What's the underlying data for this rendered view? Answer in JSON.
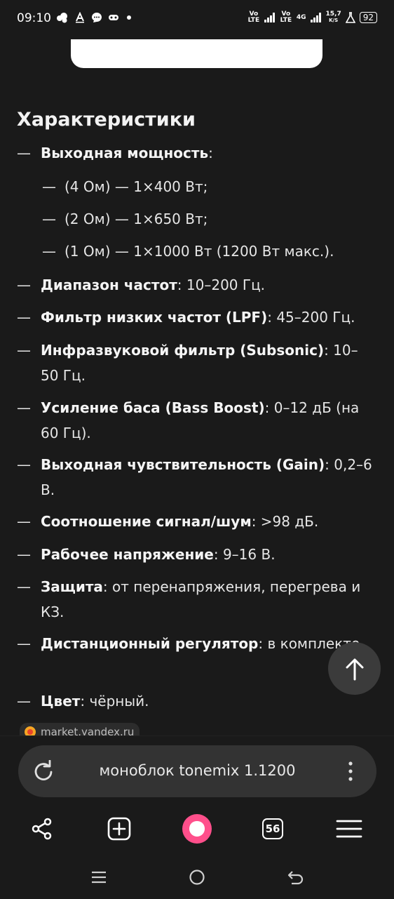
{
  "status": {
    "time": "09:10",
    "signal1": "Vo LTE",
    "signal2": "Vo LTE",
    "net": "4G",
    "speed_value": "15,7",
    "speed_unit": "K/S",
    "battery": "92"
  },
  "article": {
    "heading": "Характеристики",
    "items": [
      {
        "dash": "—",
        "bold": "Выходная мощность",
        "text": ":"
      },
      {
        "dash": "—",
        "bold": "",
        "text": "(4 Ом) — 1×400 Вт;"
      },
      {
        "dash": "—",
        "bold": "",
        "text": "(2 Ом) — 1×650 Вт;"
      },
      {
        "dash": "—",
        "bold": "",
        "text": "(1 Ом) — 1×1000 Вт (1200 Вт макс.)."
      },
      {
        "dash": "—",
        "bold": "Диапазон частот",
        "text": ": 10–200 Гц."
      },
      {
        "dash": "—",
        "bold": "Фильтр низких частот (LPF)",
        "text": ": 45–200 Гц."
      },
      {
        "dash": "—",
        "bold": "Инфразвуковой фильтр (Subsonic)",
        "text": ": 10–50 Гц."
      },
      {
        "dash": "—",
        "bold": "Усиление баса (Bass Boost)",
        "text": ": 0–12 дБ (на 60 Гц)."
      },
      {
        "dash": "—",
        "bold": "Выходная чувствительность (Gain)",
        "text": ": 0,2–6 В."
      },
      {
        "dash": "—",
        "bold": "Соотношение сигнал/шум",
        "text": ": >98 дБ."
      },
      {
        "dash": "—",
        "bold": "Рабочее напряжение",
        "text": ": 9–16 В."
      },
      {
        "dash": "—",
        "bold": "Защита",
        "text": ": от перенапряжения, перегрева и КЗ."
      },
      {
        "dash": "—",
        "bold": "Дистанционный регулятор",
        "text": ": в комплекте."
      },
      {
        "dash": "—",
        "bold": "Цвет",
        "text": ": чёрный."
      }
    ],
    "source": "market.yandex.ru"
  },
  "search": {
    "query": "моноблок tonemix 1.1200"
  },
  "toolbar": {
    "tabs_count": "56"
  },
  "colors": {
    "background": "#1a1a1a",
    "pill": "#333333",
    "alice_accent": "#ff4f8b"
  },
  "icons": [
    "reload-icon",
    "more-vert-icon",
    "share-icon",
    "new-tab-icon",
    "alice-icon",
    "tabs-icon",
    "menu-icon",
    "arrow-up-icon",
    "recents-icon",
    "home-icon",
    "back-icon"
  ]
}
